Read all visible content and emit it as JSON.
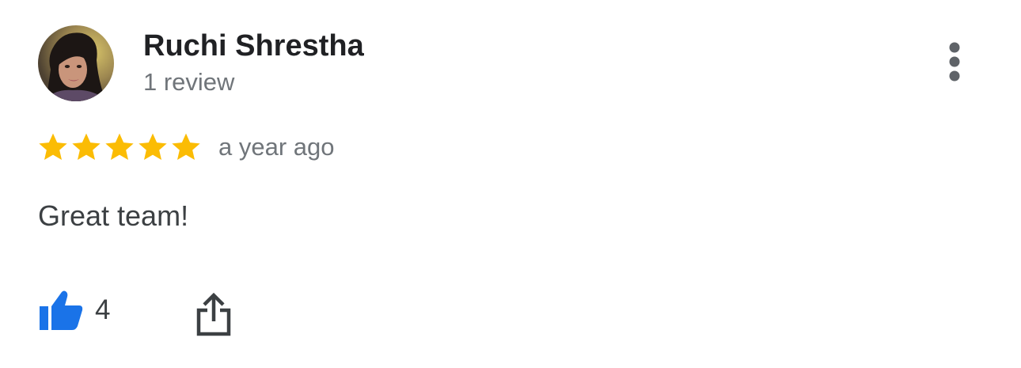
{
  "review": {
    "author_name": "Ruchi Shrestha",
    "author_review_count": "1 review",
    "rating": 5,
    "rating_max": 5,
    "time": "a year ago",
    "text": "Great team!",
    "like_count": "4"
  },
  "icons": {
    "more": "more-vert-icon",
    "star": "star-icon",
    "like": "thumb-up-icon",
    "share": "share-icon"
  },
  "colors": {
    "star": "#fbbc04",
    "like": "#1a73e8",
    "icon_gray": "#5f6368",
    "name": "#202124",
    "secondary_text": "#70757a",
    "body_text": "#3c4043"
  }
}
